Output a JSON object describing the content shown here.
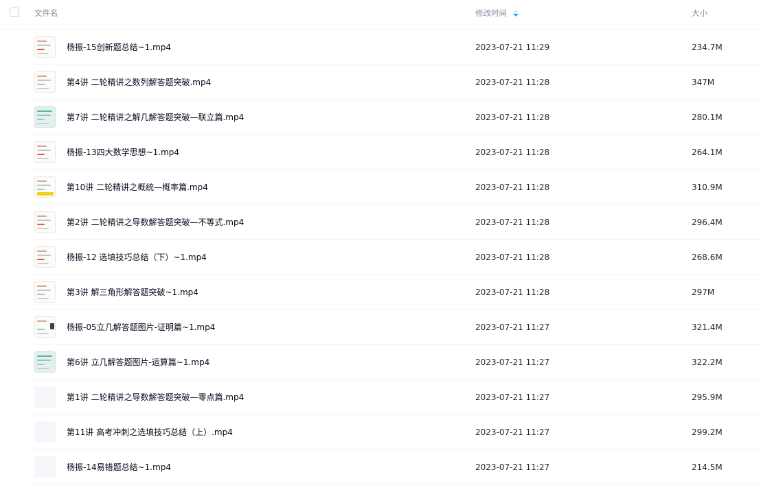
{
  "header": {
    "name_label": "文件名",
    "time_label": "修改时间",
    "size_label": "大小",
    "sort_icon": "sort-icon",
    "sort_color": "#06a7ff"
  },
  "files": [
    {
      "name": "杨振-15创新题总结~1.mp4",
      "time": "2023-07-21 11:29",
      "size": "234.7M",
      "thumbnail": "pic"
    },
    {
      "name": "第4讲 二轮精讲之数列解答题突破.mp4",
      "time": "2023-07-21 11:28",
      "size": "347M",
      "thumbnail": "pic"
    },
    {
      "name": "第7讲 二轮精讲之解几解答题突破—联立篇.mp4",
      "time": "2023-07-21 11:28",
      "size": "280.1M",
      "thumbnail": "pic"
    },
    {
      "name": "杨振-13四大数学思想~1.mp4",
      "time": "2023-07-21 11:28",
      "size": "264.1M",
      "thumbnail": "pic"
    },
    {
      "name": "第10讲 二轮精讲之概统—概率篇.mp4",
      "time": "2023-07-21 11:28",
      "size": "310.9M",
      "thumbnail": "pic"
    },
    {
      "name": "第2讲 二轮精讲之导数解答题突破—不等式.mp4",
      "time": "2023-07-21 11:28",
      "size": "296.4M",
      "thumbnail": "pic"
    },
    {
      "name": "杨振-12 选填技巧总结（下）~1.mp4",
      "time": "2023-07-21 11:28",
      "size": "268.6M",
      "thumbnail": "pic"
    },
    {
      "name": "第3讲 解三角形解答题突破~1.mp4",
      "time": "2023-07-21 11:28",
      "size": "297M",
      "thumbnail": "pic"
    },
    {
      "name": "杨振-05立几解答题图片-证明篇~1.mp4",
      "time": "2023-07-21 11:27",
      "size": "321.4M",
      "thumbnail": "pic"
    },
    {
      "name": "第6讲 立几解答题图片-运算篇~1.mp4",
      "time": "2023-07-21 11:27",
      "size": "322.2M",
      "thumbnail": "pic"
    },
    {
      "name": "第1讲 二轮精讲之导数解答题突破—零点篇.mp4",
      "time": "2023-07-21 11:27",
      "size": "295.9M",
      "thumbnail": "blank"
    },
    {
      "name": "第11讲 高考冲刺之选填技巧总结（上）.mp4",
      "time": "2023-07-21 11:27",
      "size": "299.2M",
      "thumbnail": "blank"
    },
    {
      "name": "杨振-14易错题总结~1.mp4",
      "time": "2023-07-21 11:27",
      "size": "214.5M",
      "thumbnail": "blank"
    }
  ]
}
